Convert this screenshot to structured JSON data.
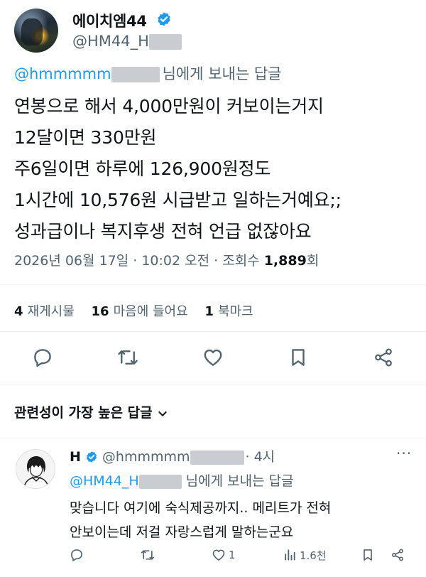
{
  "tweet": {
    "author_name": "에이치엠44",
    "author_handle_prefix": "@HM44_H",
    "reply_to_prefix": "@hmmmmm",
    "reply_to_suffix": "님에게 보내는 답글",
    "lines": [
      "연봉으로 해서 4,000만원이 커보이는거지",
      "12달이면 330만원",
      "주6일이면 하루에 126,900원정도",
      "1시간에 10,576원 시급받고 일하는거예요;;",
      "성과급이나 복지후생 전혀 언급 없잖아요"
    ],
    "timestamp": "2026년 06월 17일 · 10:02 오전 · 조회수 ",
    "views": "1,889",
    "views_suffix": "회"
  },
  "stats": {
    "retweets": "4",
    "retweets_label": "재게시물",
    "likes": "16",
    "likes_label": "마음에 들어요",
    "bookmarks": "1",
    "bookmarks_label": "북마크"
  },
  "actions": {
    "icons": [
      "reply-icon",
      "retweet-icon",
      "like-icon",
      "bookmark-icon",
      "share-icon"
    ]
  },
  "sort": {
    "label": "관련성이 가장 높은 답글"
  },
  "reply": {
    "name": "H",
    "handle_prefix": "@hmmmmm",
    "time": "· 4시",
    "more": "···",
    "reply_to_prefix": "@HM44_H",
    "reply_to_suffix": "님에게 보내는 답글",
    "lines": [
      "맞습니다 여기에 숙식제공까지.. 메리트가 전혀",
      "안보이는데 저걸 자랑스럽게 말하는군요"
    ],
    "likes": "1",
    "views": "1.6천"
  },
  "colors": {
    "accent": "#1d9bf0",
    "muted": "#536471",
    "text": "#0f1419"
  }
}
